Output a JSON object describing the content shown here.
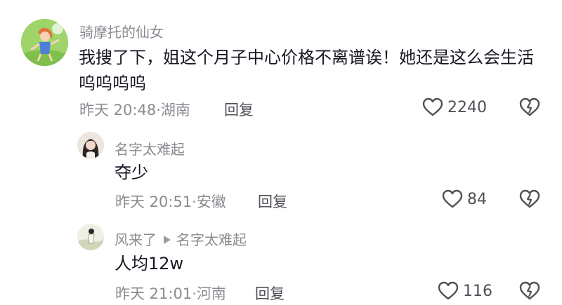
{
  "comment": {
    "author": "骑摩托的仙女",
    "text": "我搜了下，姐这个月子中心价格不离谱诶！她还是这么会生活呜呜呜呜",
    "time": "昨天 20:48·湖南",
    "reply_label": "回复",
    "likes": "2240",
    "avatar_icon": "cartoon-girl-avatar"
  },
  "replies": [
    {
      "author": "名字太难起",
      "text": "夺少",
      "time": "昨天 20:51·安徽",
      "reply_label": "回复",
      "likes": "84"
    },
    {
      "author": "风来了",
      "reply_to": "名字太难起",
      "text": "人均12w",
      "time": "昨天 21:01·河南",
      "reply_label": "回复",
      "likes": "116"
    }
  ],
  "icons": {
    "like": "heart-outline-icon",
    "dislike": "broken-heart-icon",
    "reply_arrow": "triangle-right-icon"
  },
  "colors": {
    "primary_text": "#161823",
    "secondary_text": "#8a8b91",
    "icon": "#4f5057"
  }
}
